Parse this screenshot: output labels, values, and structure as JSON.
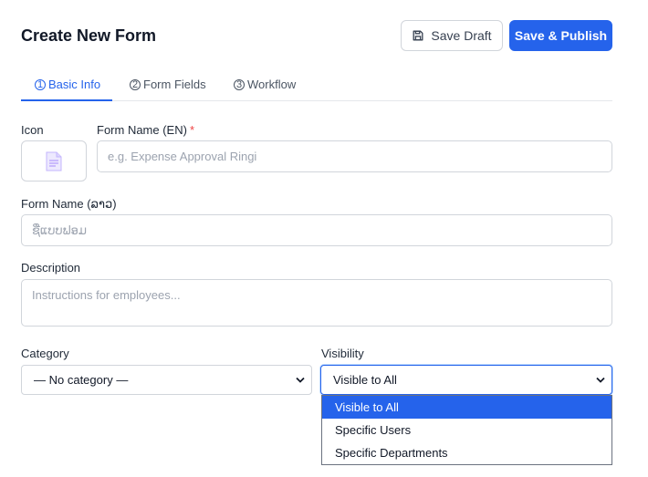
{
  "header": {
    "title": "Create New Form",
    "save_draft_label": "Save Draft",
    "save_publish_label": "Save & Publish"
  },
  "tabs": [
    {
      "num": "1",
      "label": "Basic Info",
      "active": true
    },
    {
      "num": "2",
      "label": "Form Fields",
      "active": false
    },
    {
      "num": "3",
      "label": "Workflow",
      "active": false
    }
  ],
  "form": {
    "icon_label": "Icon",
    "icon_name": "document-icon",
    "name_en_label": "Form Name (EN)",
    "name_en_required": "*",
    "name_en_placeholder": "e.g. Expense Approval Ringi",
    "name_en_value": "",
    "name_lo_label": "Form Name (ລາວ)",
    "name_lo_placeholder": "ຊື່ແບບຟອມ",
    "name_lo_value": "",
    "description_label": "Description",
    "description_placeholder": "Instructions for employees...",
    "description_value": "",
    "category_label": "Category",
    "category_selected": "— No category —",
    "visibility_label": "Visibility",
    "visibility_selected": "Visible to All",
    "visibility_options": [
      "Visible to All",
      "Specific Users",
      "Specific Departments"
    ]
  },
  "colors": {
    "accent": "#2563eb",
    "required": "#ef4444",
    "border": "#d1d5db"
  }
}
